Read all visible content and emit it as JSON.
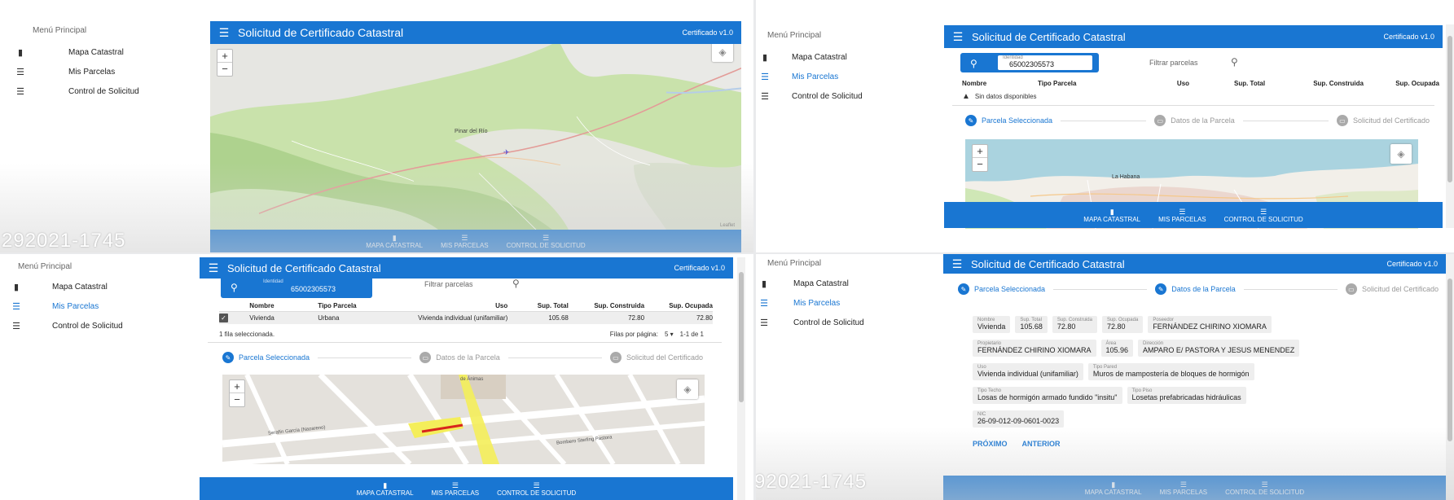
{
  "app": {
    "title": "Solicitud de Certificado Catastral",
    "version": "Certificado v1.0",
    "menu_title": "Menú Principal"
  },
  "sidebar": {
    "items": [
      {
        "label": "Mapa Catastral",
        "icon": "map-icon"
      },
      {
        "label": "Mis Parcelas",
        "icon": "list-icon"
      },
      {
        "label": "Control de Solicitud",
        "icon": "list-icon"
      }
    ]
  },
  "bottomnav": {
    "items": [
      "MAPA CATASTRAL",
      "MIS PARCELAS",
      "CONTROL DE SOLICITUD"
    ]
  },
  "map": {
    "zoom_in": "+",
    "zoom_out": "−",
    "place_label": "Pinar del Río",
    "city_label": "La Habana",
    "attribution": "Leaflet"
  },
  "search": {
    "field_label": "Identidad",
    "value": "65002305573",
    "filter_placeholder": "Filtrar parcelas"
  },
  "table": {
    "headers": [
      "Nombre",
      "Tipo Parcela",
      "Uso",
      "Sup. Total",
      "Sup. Construida",
      "Sup. Ocupada"
    ],
    "empty_text": "Sin datos disponibles",
    "rows": [
      [
        "Vivienda",
        "Urbana",
        "Vivienda individual (unifamiliar)",
        "105.68",
        "72.80",
        "72.80"
      ]
    ],
    "selected_text": "1 fila seleccionada.",
    "rows_per_page_label": "Filas por página:",
    "rows_per_page": "5",
    "range": "1-1 de 1"
  },
  "stepper": {
    "steps": [
      "Parcela Seleccionada",
      "Datos de la Parcela",
      "Solicitud del Certificado"
    ]
  },
  "street_map": {
    "streets": [
      "Serafín García (Nazareno)",
      "Bombero Sterling Pastora",
      "de Ánimas"
    ]
  },
  "details": {
    "rows": [
      [
        {
          "k": "Nombre",
          "v": "Vivienda"
        },
        {
          "k": "Sup. Total",
          "v": "105.68"
        },
        {
          "k": "Sup. Construida",
          "v": "72.80"
        },
        {
          "k": "Sup. Ocupada",
          "v": "72.80"
        },
        {
          "k": "Poseedor",
          "v": "FERNÁNDEZ CHIRINO XIOMARA"
        }
      ],
      [
        {
          "k": "Propietario",
          "v": "FERNÁNDEZ CHIRINO XIOMARA"
        },
        {
          "k": "Área",
          "v": "105.96"
        },
        {
          "k": "Dirección",
          "v": "AMPARO E/ PASTORA Y JESUS MENENDEZ"
        }
      ],
      [
        {
          "k": "Uso",
          "v": "Vivienda individual (unifamiliar)"
        },
        {
          "k": "Tipo Pared",
          "v": "Muros de mampostería de bloques de hormigón"
        }
      ],
      [
        {
          "k": "Tipo Techo",
          "v": "Losas de hormigón armado fundido \"insitu\""
        },
        {
          "k": "Tipo Piso",
          "v": "Losetas prefabricadas hidráulicas"
        }
      ],
      [
        {
          "k": "NIC",
          "v": "26-09-012-09-0601-0023"
        }
      ]
    ],
    "next": "PRÓXIMO",
    "back": "ANTERIOR"
  },
  "overlay": {
    "q1": "292021-1745",
    "q4": "92021-1745"
  },
  "colors": {
    "primary": "#1976d2",
    "map_green": "#b8d89a",
    "map_road": "#e6a3a0",
    "parcel_yellow": "#f4ee5a",
    "parcel_red": "#d8261c"
  }
}
